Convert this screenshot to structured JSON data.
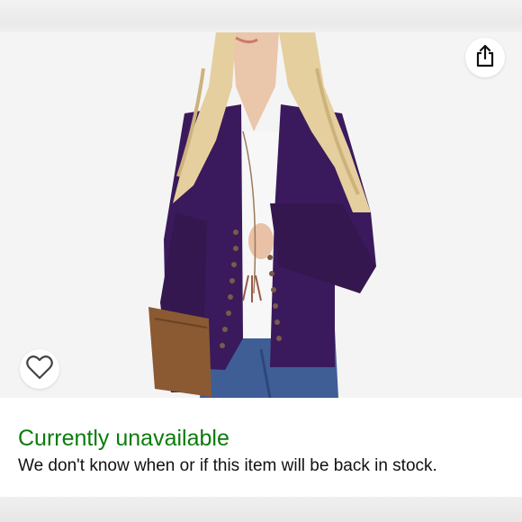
{
  "product": {
    "availability": "Currently unavailable",
    "stock_note": "We don't know when or if this item will be back in stock."
  },
  "icons": {
    "share": "share-icon",
    "wishlist": "heart-icon"
  },
  "colors": {
    "availability_text": "#0a7c0a",
    "cardigan": "#3a1a5c",
    "page_background": "#ececec"
  }
}
